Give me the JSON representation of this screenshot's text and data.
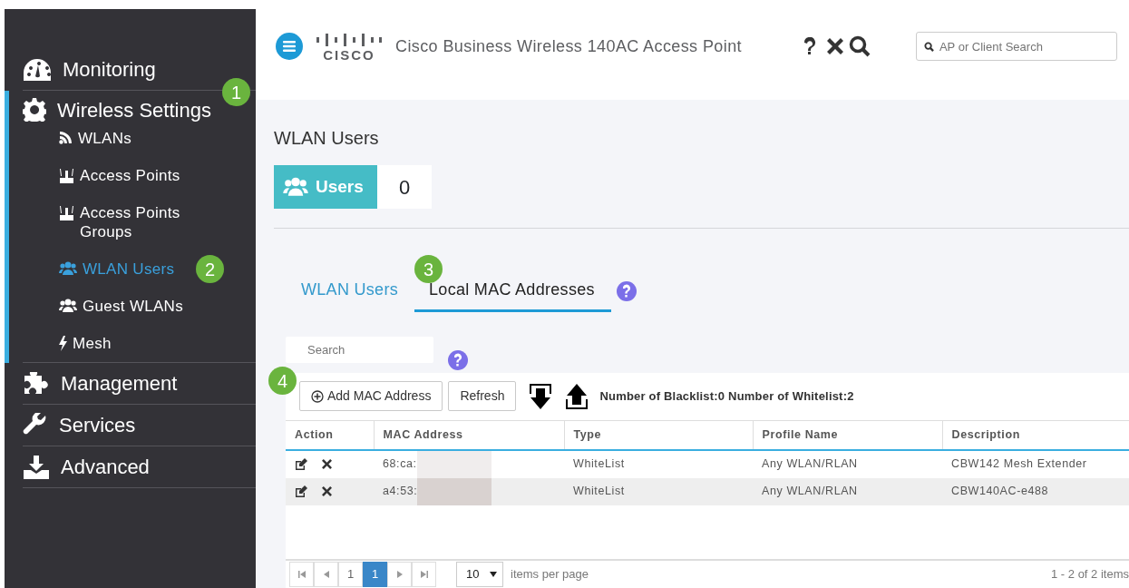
{
  "sidebar": {
    "items": [
      {
        "label": "Monitoring",
        "expanded": false
      },
      {
        "label": "Wireless Settings",
        "expanded": true,
        "children": [
          {
            "label": "WLANs",
            "selected": false
          },
          {
            "label": "Access Points",
            "selected": false
          },
          {
            "label": "Access Points Groups",
            "selected": false
          },
          {
            "label": "WLAN Users",
            "selected": true
          },
          {
            "label": "Guest WLANs",
            "selected": false
          },
          {
            "label": "Mesh",
            "selected": false
          }
        ]
      },
      {
        "label": "Management",
        "expanded": false
      },
      {
        "label": "Services",
        "expanded": false
      },
      {
        "label": "Advanced",
        "expanded": false
      }
    ]
  },
  "header": {
    "logo_text": "CISCO",
    "title": "Cisco Business Wireless 140AC Access Point",
    "search": {
      "placeholder": "AP or Client Search"
    }
  },
  "page": {
    "title": "WLAN Users",
    "users_tile": {
      "label": "Users",
      "count": "0"
    }
  },
  "tabs": [
    {
      "label": "WLAN Users",
      "selected": false
    },
    {
      "label": "Local MAC Addresses",
      "selected": true
    }
  ],
  "search": {
    "placeholder": "Search"
  },
  "toolbar": {
    "add_button": "Add MAC Address",
    "refresh_button": "Refresh",
    "stats": "Number of Blacklist:0 Number of Whitelist:2"
  },
  "table": {
    "columns": [
      "Action",
      "MAC Address",
      "Type",
      "Profile Name",
      "Description"
    ],
    "rows": [
      {
        "mac": "68:ca:",
        "type": "WhiteList",
        "profile": "Any WLAN/RLAN",
        "description": "CBW142 Mesh Extender"
      },
      {
        "mac": "a4:53:",
        "type": "WhiteList",
        "profile": "Any WLAN/RLAN",
        "description": "CBW140AC-e488"
      }
    ]
  },
  "pager": {
    "pages": [
      {
        "label": "1",
        "selected": false
      },
      {
        "label": "1",
        "selected": true
      }
    ],
    "page_size": "10",
    "page_size_label": "items per page",
    "summary": "1 - 2 of 2 items"
  },
  "callouts": [
    "1",
    "2",
    "3",
    "4"
  ]
}
